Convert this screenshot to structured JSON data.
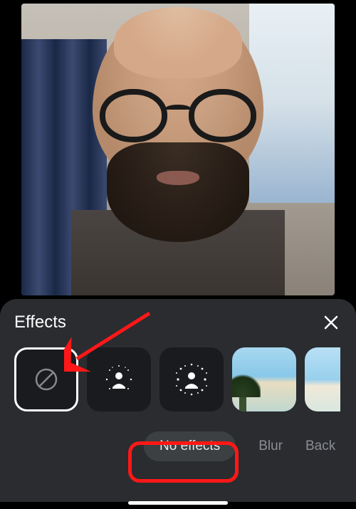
{
  "panel": {
    "title": "Effects",
    "close": "✕"
  },
  "effects": {
    "none": "No effects",
    "blur": "Blur",
    "back": "Back"
  }
}
